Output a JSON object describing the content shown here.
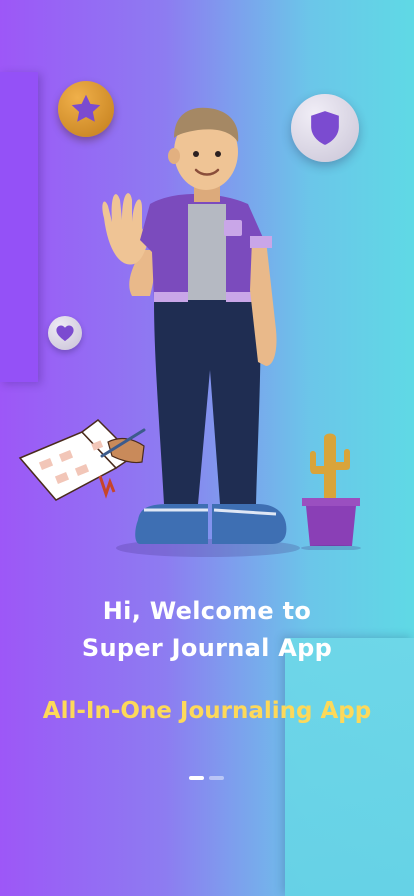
{
  "onboarding": {
    "headline_line1": "Hi, Welcome to",
    "headline_line2": "Super Journal App",
    "subtitle": "All-In-One Journaling App",
    "page_indicator": {
      "total": 2,
      "active": 1
    }
  },
  "decorations": {
    "icons": [
      "star-icon",
      "shield-icon",
      "heart-icon"
    ],
    "illustrations": [
      "waving-man-character",
      "journal-writing-illustration",
      "potted-cactus"
    ]
  },
  "colors": {
    "gradient_start": "#9d57f7",
    "gradient_end": "#5fd9e5",
    "subtitle": "#fdd95a",
    "headline": "#ffffff",
    "accent_purple": "#7b4bd0"
  }
}
